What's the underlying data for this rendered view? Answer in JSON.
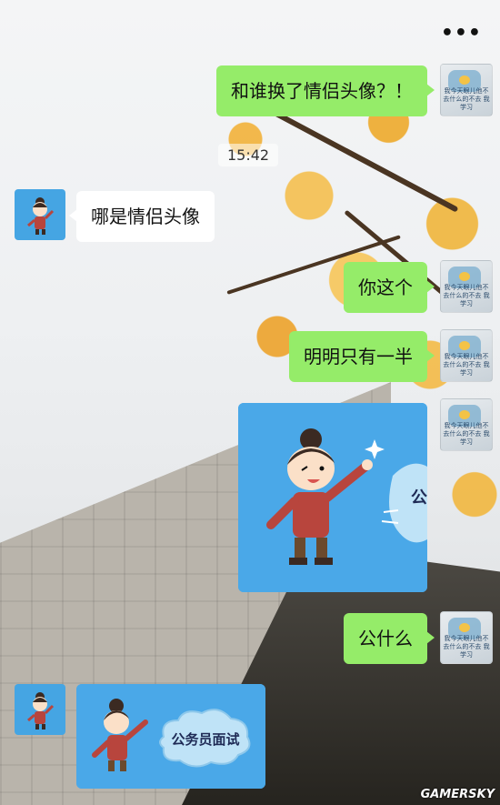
{
  "header": {
    "more_icon": "more-horizontal-icon",
    "more_glyph": "•••"
  },
  "messages": [
    {
      "side": "right",
      "type": "text",
      "text": "和谁换了情侣头像？！"
    },
    {
      "type": "timestamp",
      "text": "15:42"
    },
    {
      "side": "left",
      "type": "text",
      "text": "哪是情侣头像"
    },
    {
      "side": "right",
      "type": "text",
      "text": "你这个"
    },
    {
      "side": "right",
      "type": "text",
      "text": "明明只有一半"
    },
    {
      "side": "right",
      "type": "sticker",
      "partial_text": "公"
    },
    {
      "side": "right",
      "type": "text",
      "text": "公什么"
    },
    {
      "side": "left",
      "type": "sticker",
      "cloud_text": "公务员面试"
    }
  ],
  "avatar_right": {
    "caption": "我今天眼儿他不去什么的不去 我学习"
  },
  "colors": {
    "bubble_self": "#95ec69",
    "bubble_other": "#ffffff",
    "sticker_bg": "#4aa8e8"
  },
  "watermark": "GAMERSKY"
}
